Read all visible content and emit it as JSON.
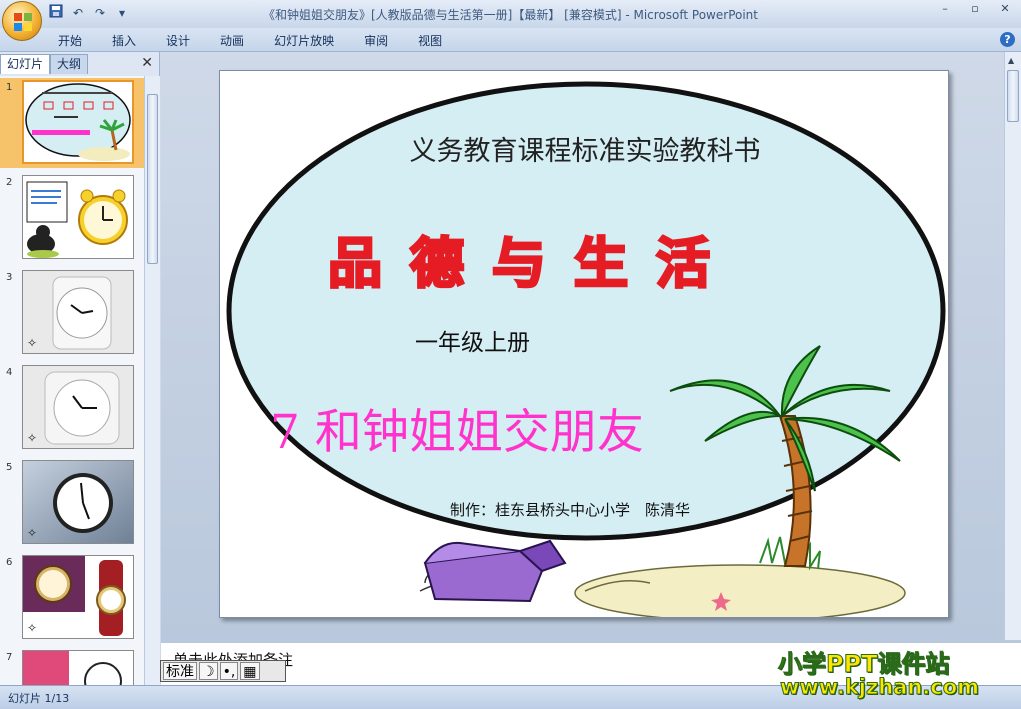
{
  "window": {
    "title": "《和钟姐姐交朋友》[人教版品德与生活第一册]【最新】 [兼容模式] - Microsoft PowerPoint",
    "minimize": "–",
    "restore": "▫",
    "close": "✕"
  },
  "quick_access": {
    "save_icon": "save-icon",
    "undo_icon": "undo-icon",
    "redo_icon": "redo-icon",
    "customize_icon": "customize-icon"
  },
  "ribbon": {
    "tabs": [
      "开始",
      "插入",
      "设计",
      "动画",
      "幻灯片放映",
      "审阅",
      "视图"
    ]
  },
  "left_panel": {
    "tabs": [
      "幻灯片",
      "大纲"
    ],
    "close": "✕",
    "thumbnails": [
      {
        "num": "1",
        "selected": true
      },
      {
        "num": "2",
        "selected": false
      },
      {
        "num": "3",
        "selected": false
      },
      {
        "num": "4",
        "selected": false
      },
      {
        "num": "5",
        "selected": false
      },
      {
        "num": "6",
        "selected": false
      },
      {
        "num": "7",
        "selected": false
      }
    ]
  },
  "slide": {
    "top_line": "义务教育课程标准实验教科书",
    "brand": "品德与生活",
    "grade": "一年级上册",
    "lesson": "7 和钟姐姐交朋友",
    "author": "制作：桂东县桥头中心小学　陈清华"
  },
  "notes": {
    "text": "单击此处添加备注"
  },
  "ime": {
    "mode": "标准",
    "moon": "☽",
    "punct": "•,",
    "keyboard": "▦"
  },
  "watermark": {
    "line1": "小学PPT课件站",
    "line2": "www.kjzhan.com"
  },
  "status": {
    "slide_count": "幻灯片 1/13"
  },
  "colors": {
    "ellipse_fill": "#d4eef4",
    "brand_red": "#e51c23",
    "lesson_magenta": "#ff33cc",
    "thumbnail_selected": "#f6c36a"
  }
}
